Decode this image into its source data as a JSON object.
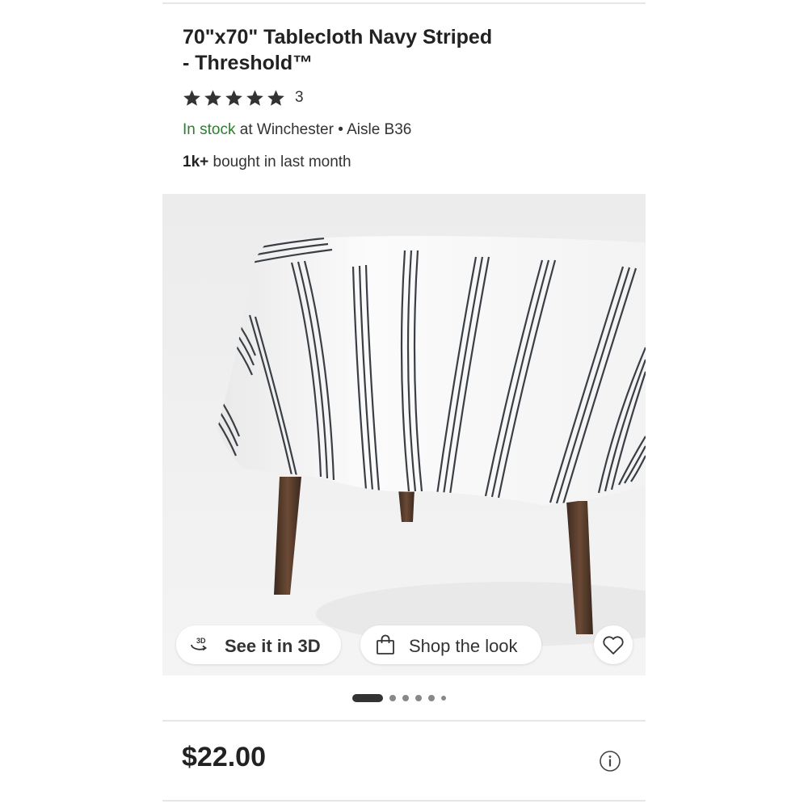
{
  "product": {
    "title_line1": "70\"x70\" Tablecloth Navy Striped",
    "title_line2": "- Threshold™",
    "rating": {
      "stars": 5,
      "count": "3"
    },
    "stock": {
      "status": "In stock",
      "location": "at Winchester • Aisle B36"
    },
    "bought": {
      "count": "1k+",
      "text": "bought in last month"
    },
    "price": "$22.00"
  },
  "gallery": {
    "see3d_icon_text": "3D",
    "see3d_label": "See it in 3D",
    "shop_label": "Shop the look",
    "slides": 6,
    "active_slide": 1
  },
  "icons": {
    "star": "star-icon",
    "three_d": "3d-rotate-icon",
    "bag": "shopping-bag-icon",
    "heart": "heart-icon",
    "info": "info-icon"
  },
  "colors": {
    "in_stock": "#2f7d32",
    "stripe": "#3a3f45"
  }
}
